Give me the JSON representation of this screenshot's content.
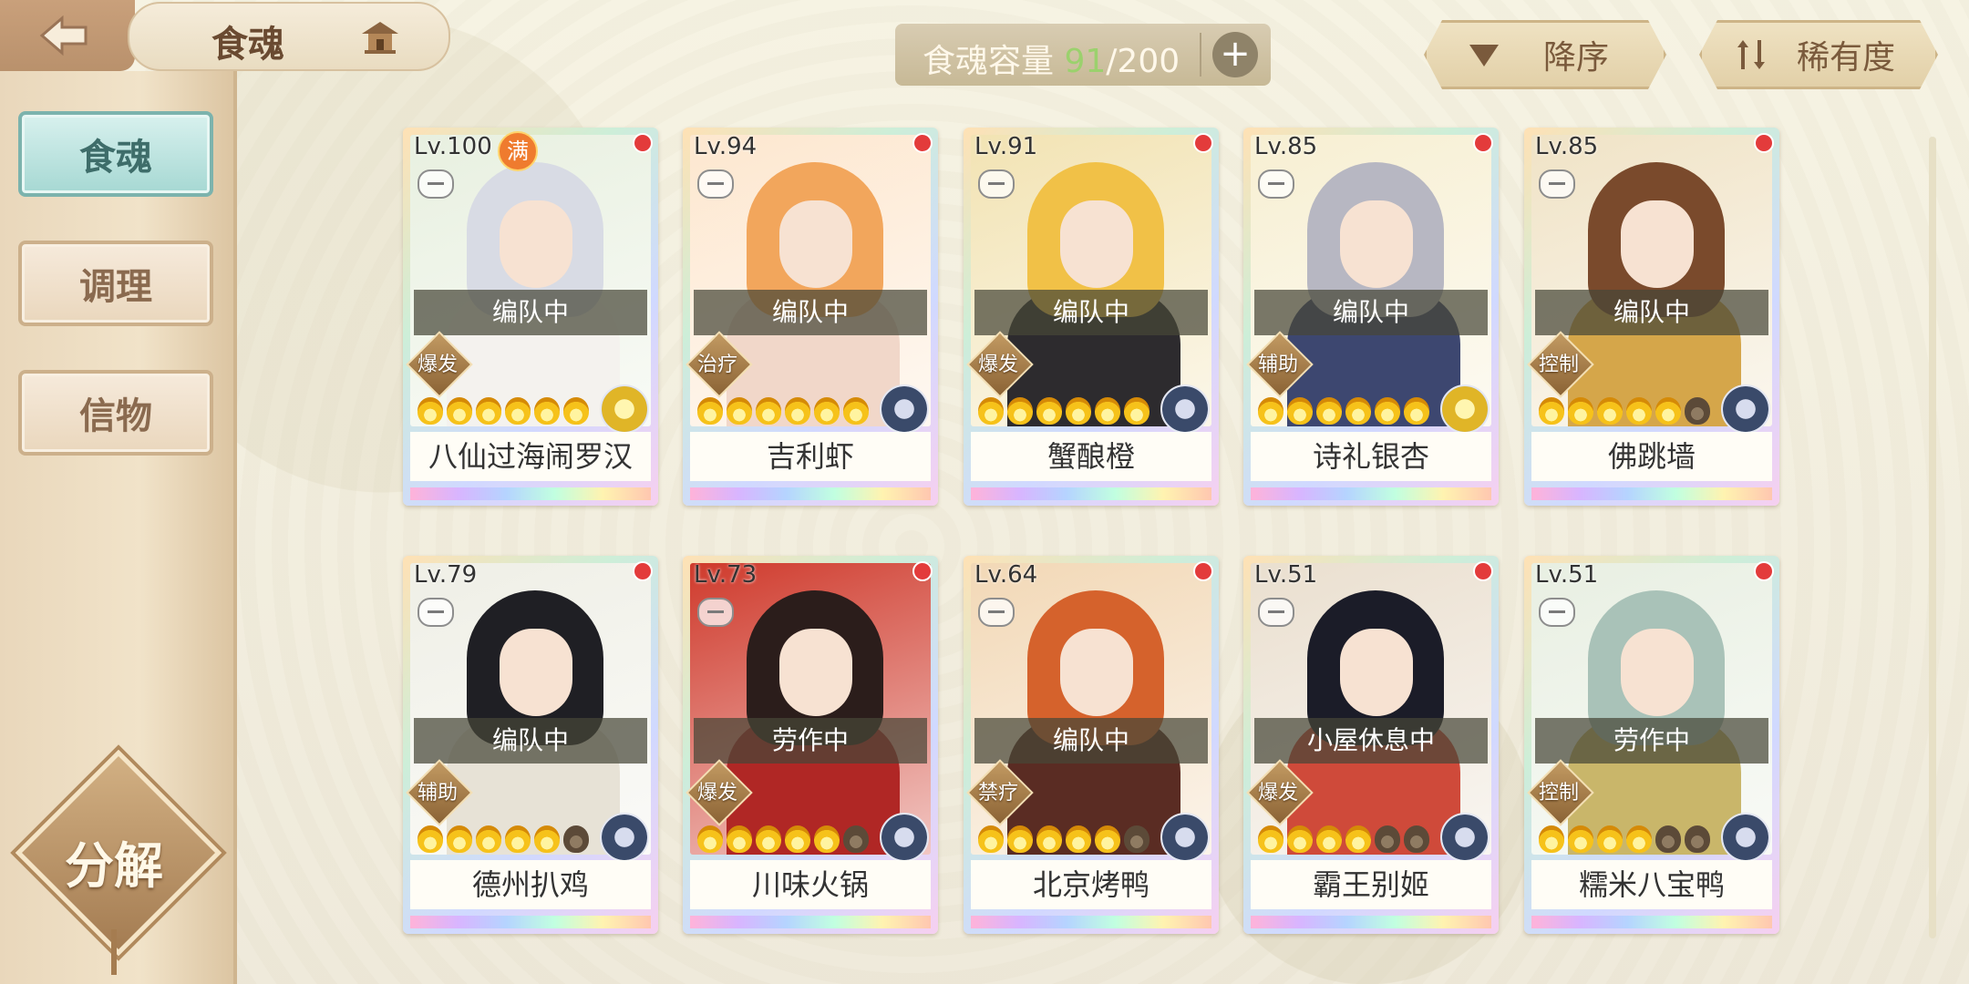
{
  "header": {
    "title": "食魂",
    "back_icon": "back-arrow-icon",
    "house_icon": "pavilion-icon"
  },
  "sidebar": {
    "items": [
      {
        "label": "食魂",
        "active": true
      },
      {
        "label": "调理",
        "active": false
      },
      {
        "label": "信物",
        "active": false
      }
    ],
    "decompose_label": "分解"
  },
  "capacity": {
    "label": "食魂容量",
    "current": "91",
    "total": "/200",
    "add_icon": "plus-icon"
  },
  "sort": {
    "order_label": "降序",
    "rarity_label": "稀有度"
  },
  "colors": {
    "accent_teal": "#7cb3ad",
    "brown": "#6a4a31",
    "capacity_green": "#9bd16d"
  },
  "cards": [
    {
      "level": "Lv.100",
      "full": "满",
      "status": "编队中",
      "role": "爆发",
      "stars": 6,
      "filled": 6,
      "element": "gold",
      "name": "八仙过海闹罗汉",
      "hair": "#d8dbe4",
      "body": "#f4f2ee",
      "bg": "#e8f0e0"
    },
    {
      "level": "Lv.94",
      "full": "",
      "status": "编队中",
      "role": "治疗",
      "stars": 6,
      "filled": 6,
      "element": "blue",
      "name": "吉利虾",
      "hair": "#f2a65c",
      "body": "#f1d7c9",
      "bg": "#fde7cf"
    },
    {
      "level": "Lv.91",
      "full": "",
      "status": "编队中",
      "role": "爆发",
      "stars": 6,
      "filled": 6,
      "element": "blue",
      "name": "蟹酿橙",
      "hair": "#f1c147",
      "body": "#2d2b2e",
      "bg": "#f2e3b3"
    },
    {
      "level": "Lv.85",
      "full": "",
      "status": "编队中",
      "role": "辅助",
      "stars": 6,
      "filled": 6,
      "element": "gold",
      "name": "诗礼银杏",
      "hair": "#b7b7c2",
      "body": "#3d4770",
      "bg": "#f7efd2"
    },
    {
      "level": "Lv.85",
      "full": "",
      "status": "编队中",
      "role": "控制",
      "stars": 6,
      "filled": 5,
      "element": "blue",
      "name": "佛跳墙",
      "hair": "#7a4a2c",
      "body": "#d5a64a",
      "bg": "#f0e3c6"
    },
    {
      "level": "Lv.79",
      "full": "",
      "status": "编队中",
      "role": "辅助",
      "stars": 6,
      "filled": 5,
      "element": "blue",
      "name": "德州扒鸡",
      "hair": "#1f1f24",
      "body": "#e7e2d6",
      "bg": "#efefe6"
    },
    {
      "level": "Lv.73",
      "full": "",
      "status": "劳作中",
      "role": "爆发",
      "stars": 6,
      "filled": 5,
      "element": "blue",
      "name": "川味火锅",
      "hair": "#2b1d1b",
      "body": "#b02725",
      "bg": "#cf3a2c"
    },
    {
      "level": "Lv.64",
      "full": "",
      "status": "编队中",
      "role": "禁疗",
      "stars": 6,
      "filled": 5,
      "element": "blue",
      "name": "北京烤鸭",
      "hair": "#d5622c",
      "body": "#5a2c23",
      "bg": "#f2d8b6"
    },
    {
      "level": "Lv.51",
      "full": "",
      "status": "小屋休息中",
      "role": "爆发",
      "stars": 6,
      "filled": 4,
      "element": "blue",
      "name": "霸王别姬",
      "hair": "#1b1c28",
      "body": "#cf4a3a",
      "bg": "#eadfcf"
    },
    {
      "level": "Lv.51",
      "full": "",
      "status": "劳作中",
      "role": "控制",
      "stars": 6,
      "filled": 4,
      "element": "blue",
      "name": "糯米八宝鸭",
      "hair": "#a9c2b8",
      "body": "#c9b66a",
      "bg": "#e8efe2"
    }
  ]
}
